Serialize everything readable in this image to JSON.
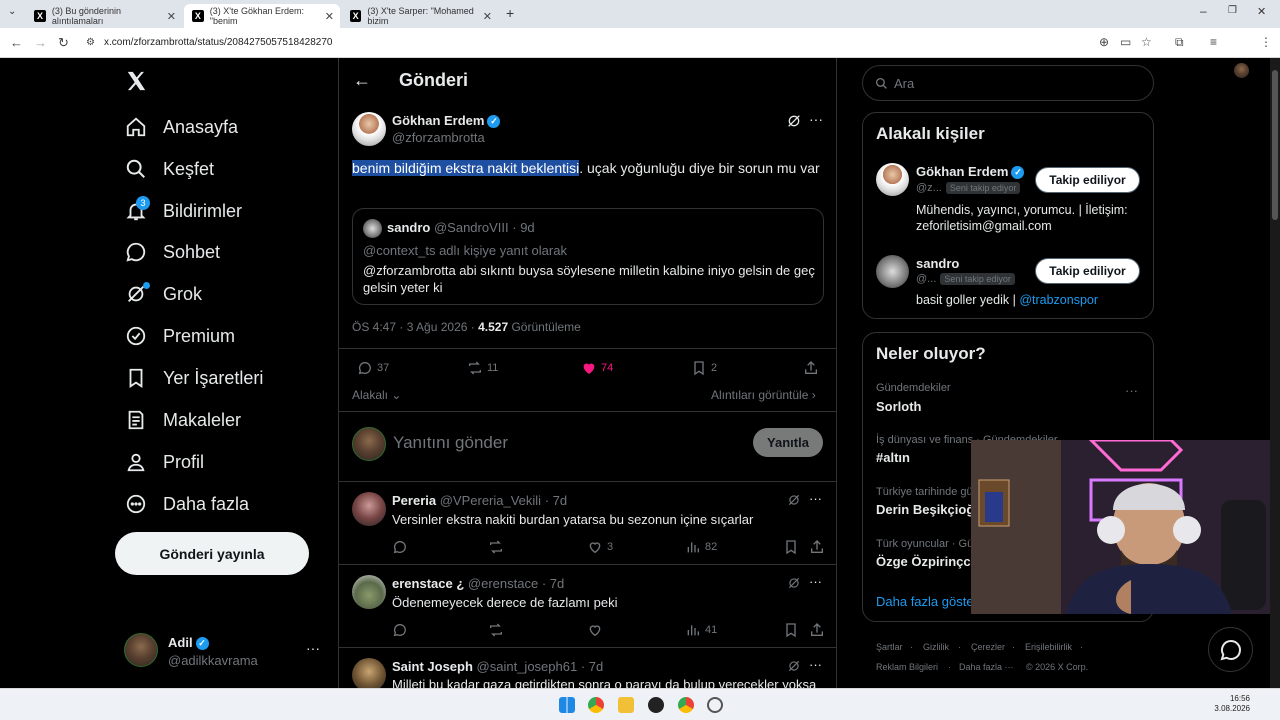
{
  "browser": {
    "tabs": [
      {
        "title": "(3) Bu gönderinin alıntılamaları"
      },
      {
        "title": "(3) X'te Gökhan Erdem: \"benim"
      },
      {
        "title": "(3) X'te Sarper: \"Mohamed bizim"
      }
    ],
    "url": "x.com/zforzambrotta/status/2084275057518428270"
  },
  "nav": {
    "items": [
      {
        "label": "Anasayfa",
        "icon": "home-icon"
      },
      {
        "label": "Keşfet",
        "icon": "search-icon"
      },
      {
        "label": "Bildirimler",
        "icon": "bell-icon"
      },
      {
        "label": "Sohbet",
        "icon": "chat-icon"
      },
      {
        "label": "Grok",
        "icon": "grok-icon"
      },
      {
        "label": "Premium",
        "icon": "premium-icon"
      },
      {
        "label": "Yer İşaretleri",
        "icon": "bookmark-icon"
      },
      {
        "label": "Makaleler",
        "icon": "article-icon"
      },
      {
        "label": "Profil",
        "icon": "profile-icon"
      },
      {
        "label": "Daha fazla",
        "icon": "more-circle-icon"
      }
    ],
    "notif_badge": "3",
    "post_button": "Gönderi yayınla",
    "account": {
      "name": "Adil",
      "handle": "@adilkkavrama"
    }
  },
  "main": {
    "header": "Gönderi",
    "tweet": {
      "name": "Gökhan Erdem",
      "handle": "@zforzambrotta",
      "text_selected": "benim bildiğim ekstra nakit beklentisi",
      "text_rest": ". uçak yoğunluğu diye bir sorun mu var",
      "quote": {
        "name": "sandro",
        "handle": "@SandroVIII",
        "sep": "·",
        "time": "9d",
        "reply_to": "@context_ts adlı kişiye yanıt olarak",
        "text": "@zforzambrotta abi sıkıntı buysa söylesene milletin kalbine iniyo gelsin de geç gelsin yeter ki"
      },
      "meta_time": "ÖS 4:47 · 3 Ağu 2026 ·",
      "views_count": "4.527",
      "views_label": "Görüntüleme",
      "stats": {
        "replies": "37",
        "reposts": "11",
        "likes": "74",
        "bookmarks": "2"
      }
    },
    "relevant_label": "Alakalı",
    "quotes_link": "Alıntıları görüntüle",
    "reply_placeholder": "Yanıtını gönder",
    "reply_button": "Yanıtla",
    "replies": [
      {
        "name": "Pereria",
        "handle": "@VPereria_Vekili",
        "sep": "·",
        "time": "7d",
        "text": "Versinler ekstra nakiti burdan yatarsa bu sezonun içine sıçarlar",
        "likes": "3",
        "views": "82"
      },
      {
        "name": "erenstace ¿",
        "handle": "@erenstace",
        "sep": "·",
        "time": "7d",
        "text": "Ödenemeyecek derece de fazlamı peki",
        "likes": "",
        "views": "41"
      },
      {
        "name": "Saint Joseph",
        "handle": "@saint_joseph61",
        "sep": "·",
        "time": "7d",
        "text": "Milleti bu kadar gaza getirdikten sonra o parayı da bulup verecekler yoksa",
        "likes": "",
        "views": ""
      }
    ]
  },
  "right": {
    "search_placeholder": "Ara",
    "people_title": "Alakalı kişiler",
    "people": [
      {
        "name": "Gökhan Erdem",
        "handle": "@z...",
        "tag": "Seni takip ediyor",
        "button": "Takip ediliyor",
        "bio": "Mühendis, yayıncı, yorumcu. | İletişim: zeforiletisim@gmail.com",
        "bio_link": ""
      },
      {
        "name": "sandro",
        "handle": "@...",
        "tag": "Seni takip ediyor",
        "button": "Takip ediliyor",
        "bio": "basit goller yedik |",
        "bio_link": "@trabzonspor"
      }
    ],
    "trends_title": "Neler oluyor?",
    "trends": [
      {
        "category": "Gündemdekiler",
        "name": "Sorloth"
      },
      {
        "category": "İş dünyası ve finans · Gündemdekiler",
        "name": "#altın"
      },
      {
        "category": "Türkiye tarihinde gü",
        "name": "Derin Beşikçioğ"
      },
      {
        "category": "Türk oyuncular · Gü",
        "name": "Özge Özpirinçci"
      }
    ],
    "trends_more": "Daha fazla göste",
    "footer": [
      "Şartlar",
      "·",
      "Gizlilik",
      "·",
      "Çerezler",
      "·",
      "Erişilebilirlik",
      "·",
      "Reklam Bilgileri",
      "·",
      "Daha fazla ···",
      "© 2026 X Corp."
    ]
  },
  "taskbar": {
    "time": "16:56",
    "date": "3.08.2026"
  },
  "colors": {
    "accent": "#1d9bf0",
    "like": "#f91880",
    "selection": "#1f4fa0",
    "border": "#2f3336",
    "muted": "#71767b"
  }
}
